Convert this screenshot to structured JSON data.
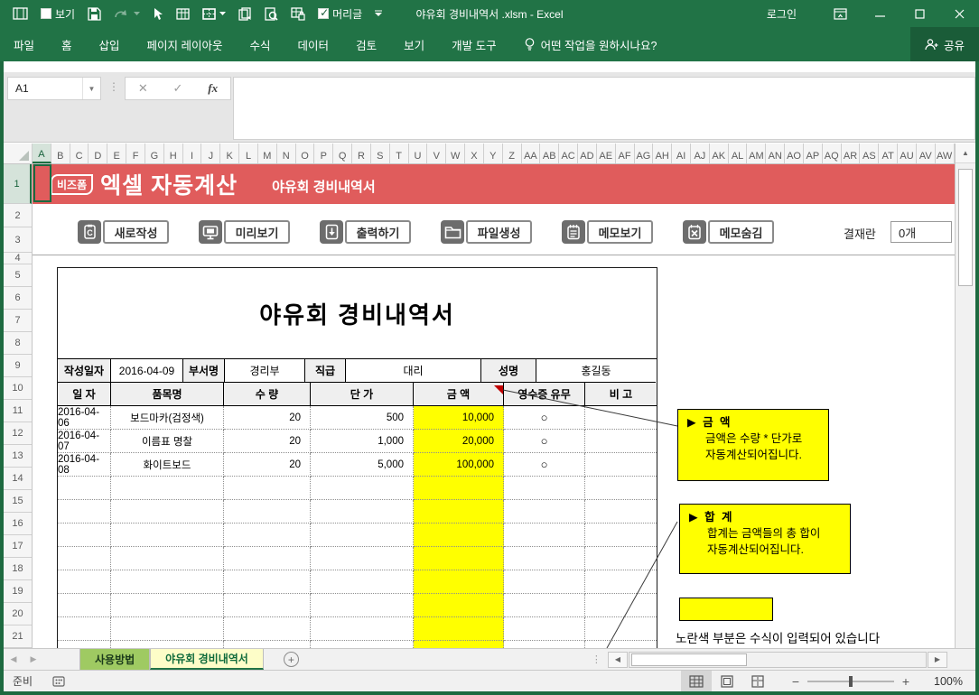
{
  "window": {
    "title": "야유회 경비내역서 .xlsm - Excel",
    "login_label": "로그인"
  },
  "qat": {
    "view_label": "보기",
    "header_label": "머리글"
  },
  "ribbon": {
    "tabs": [
      "파일",
      "홈",
      "삽입",
      "페이지 레이아웃",
      "수식",
      "데이터",
      "검토",
      "보기",
      "개발 도구"
    ],
    "tell_me": "어떤 작업을 원하시나요?",
    "share_label": "공유"
  },
  "formula_bar": {
    "name_box": "A1",
    "cancel_glyph": "✕",
    "enter_glyph": "✓",
    "fx_label": "fx"
  },
  "grid": {
    "column_letters": [
      "A",
      "B",
      "C",
      "D",
      "E",
      "F",
      "G",
      "H",
      "I",
      "J",
      "K",
      "L",
      "M",
      "N",
      "O",
      "P",
      "Q",
      "R",
      "S",
      "T",
      "U",
      "V",
      "W",
      "X",
      "Y",
      "Z",
      "AA",
      "AB",
      "AC",
      "AD",
      "AE",
      "AF",
      "AG",
      "AH",
      "AI",
      "AJ",
      "AK",
      "AL",
      "AM",
      "AN",
      "AO",
      "AP",
      "AQ",
      "AR",
      "AS",
      "AT",
      "AU",
      "AV",
      "AW"
    ],
    "row_count": 21
  },
  "banner": {
    "logo_text": "비즈폼",
    "brand_text": "엑셀 자동계산",
    "subtitle": "야유회 경비내역서",
    "bg_color": "#e05c5c"
  },
  "toolbar": {
    "buttons": [
      {
        "icon": "new-doc-icon",
        "label": "새로작성"
      },
      {
        "icon": "preview-icon",
        "label": "미리보기"
      },
      {
        "icon": "print-icon",
        "label": "출력하기"
      },
      {
        "icon": "file-create-icon",
        "label": "파일생성"
      },
      {
        "icon": "memo-show-icon",
        "label": "메모보기"
      },
      {
        "icon": "memo-hide-icon",
        "label": "메모숨김"
      }
    ],
    "approval_label": "결재란",
    "approval_value": "0개"
  },
  "document": {
    "title": "야유회 경비내역서",
    "info_cells": [
      {
        "label": "작성일자",
        "value": "2016-04-09"
      },
      {
        "label": "부서명",
        "value": "경리부"
      },
      {
        "label": "직급",
        "value": "대리"
      },
      {
        "label": "성명",
        "value": "홍길동"
      }
    ],
    "columns": [
      "일  자",
      "품목명",
      "수  량",
      "단  가",
      "금  액",
      "영수증 유무",
      "비  고"
    ],
    "rows": [
      [
        "2016-04-06",
        "보드마카(검정색)",
        "20",
        "500",
        "10,000",
        "○",
        ""
      ],
      [
        "2016-04-07",
        "이름표 명찰",
        "20",
        "1,000",
        "20,000",
        "○",
        ""
      ],
      [
        "2016-04-08",
        "화이트보드",
        "20",
        "5,000",
        "100,000",
        "○",
        ""
      ]
    ],
    "empty_row_count": 9,
    "formula_highlight_color": "#ffff00"
  },
  "callouts": [
    {
      "title": "▶ 금  액",
      "line1": "금액은 수량 * 단가로",
      "line2": "자동계산되어집니다."
    },
    {
      "title": "▶ 합  계",
      "line1": "합계는 금액들의 총 합이",
      "line2": "자동계산되어집니다."
    }
  ],
  "note": "노란색 부분은 수식이 입력되어 있습니다",
  "sheet_tabs": [
    {
      "label": "사용방법",
      "active": false
    },
    {
      "label": "야유회 경비내역서",
      "active": true
    }
  ],
  "status_bar": {
    "ready_label": "준비",
    "zoom_level": "100%"
  }
}
